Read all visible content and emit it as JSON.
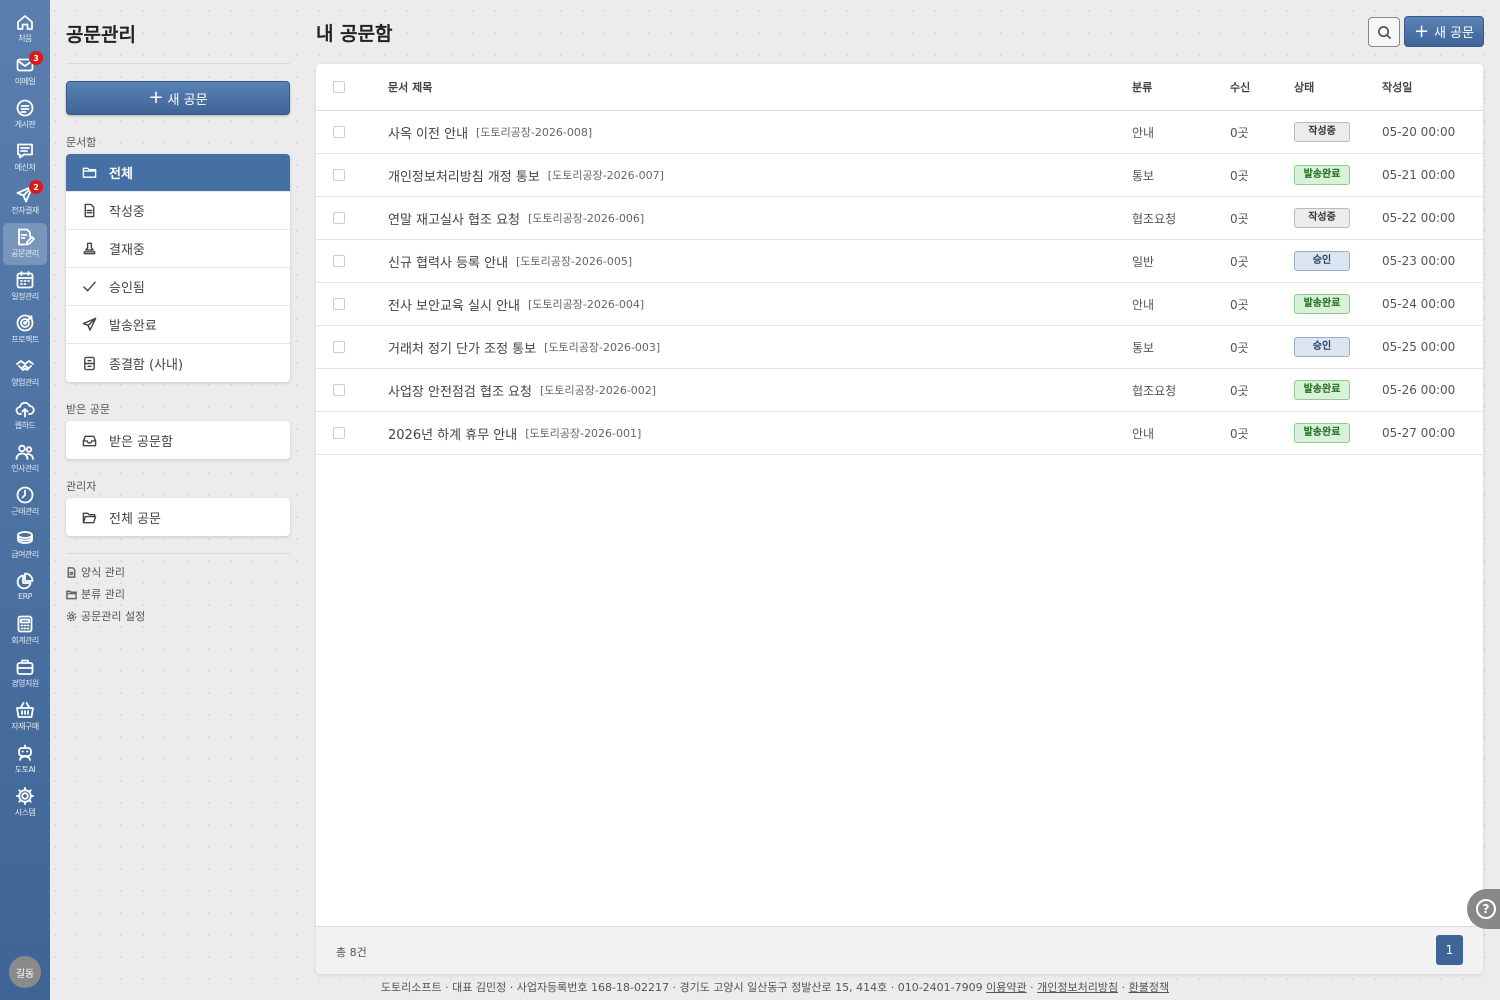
{
  "rail": {
    "items": [
      {
        "label": "처음",
        "icon": "home-icon",
        "badge": ""
      },
      {
        "label": "이메일",
        "icon": "mail-icon",
        "badge": "3"
      },
      {
        "label": "게시판",
        "icon": "board-icon",
        "badge": ""
      },
      {
        "label": "메신저",
        "icon": "chat-icon",
        "badge": ""
      },
      {
        "label": "전자결재",
        "icon": "send-icon",
        "badge": "2"
      },
      {
        "label": "공문관리",
        "icon": "document-edit-icon",
        "badge": ""
      },
      {
        "label": "일정관리",
        "icon": "calendar-icon",
        "badge": ""
      },
      {
        "label": "프로젝트",
        "icon": "target-icon",
        "badge": ""
      },
      {
        "label": "영업관리",
        "icon": "handshake-icon",
        "badge": ""
      },
      {
        "label": "웹하드",
        "icon": "cloud-upload-icon",
        "badge": ""
      },
      {
        "label": "인사관리",
        "icon": "people-icon",
        "badge": ""
      },
      {
        "label": "근태관리",
        "icon": "clock-icon",
        "badge": ""
      },
      {
        "label": "급여관리",
        "icon": "coins-icon",
        "badge": ""
      },
      {
        "label": "ERP",
        "icon": "pie-chart-icon",
        "badge": ""
      },
      {
        "label": "회계관리",
        "icon": "calculator-icon",
        "badge": ""
      },
      {
        "label": "경영지원",
        "icon": "briefcase-icon",
        "badge": ""
      },
      {
        "label": "자재구매",
        "icon": "basket-icon",
        "badge": ""
      },
      {
        "label": "도토AI",
        "icon": "robot-icon",
        "badge": ""
      },
      {
        "label": "시스템",
        "icon": "gear-icon",
        "badge": ""
      }
    ],
    "avatar": "길동"
  },
  "sidebar": {
    "title": "공문관리",
    "new_button": "새 공문",
    "section_docbox": "문서함",
    "docbox": [
      "전체",
      "작성중",
      "결재중",
      "승인됨",
      "발송완료",
      "종결함 (사내)"
    ],
    "section_received": "받은 공문",
    "received": [
      "받은 공문함"
    ],
    "section_admin": "관리자",
    "admin": [
      "전체 공문"
    ],
    "links": [
      "양식 관리",
      "분류 관리",
      "공문관리 설정"
    ]
  },
  "header": {
    "title": "내 공문함",
    "new_button": "새 공문"
  },
  "table": {
    "headers": {
      "title": "문서 제목",
      "category": "분류",
      "recipients": "수신",
      "status": "상태",
      "date": "작성일"
    },
    "rows": [
      {
        "title": "사옥 이전 안내",
        "doc_no": "[도토리공장-2026-008]",
        "category": "안내",
        "recipients": "0곳",
        "status": "작성중",
        "status_type": "draft",
        "date": "05-20 00:00"
      },
      {
        "title": "개인정보처리방침 개정 통보",
        "doc_no": "[도토리공장-2026-007]",
        "category": "통보",
        "recipients": "0곳",
        "status": "발송완료",
        "status_type": "sent",
        "date": "05-21 00:00"
      },
      {
        "title": "연말 재고실사 협조 요청",
        "doc_no": "[도토리공장-2026-006]",
        "category": "협조요청",
        "recipients": "0곳",
        "status": "작성중",
        "status_type": "draft",
        "date": "05-22 00:00"
      },
      {
        "title": "신규 협력사 등록 안내",
        "doc_no": "[도토리공장-2026-005]",
        "category": "일반",
        "recipients": "0곳",
        "status": "승인",
        "status_type": "approved",
        "date": "05-23 00:00"
      },
      {
        "title": "전사 보안교육 실시 안내",
        "doc_no": "[도토리공장-2026-004]",
        "category": "안내",
        "recipients": "0곳",
        "status": "발송완료",
        "status_type": "sent",
        "date": "05-24 00:00"
      },
      {
        "title": "거래처 정기 단가 조정 통보",
        "doc_no": "[도토리공장-2026-003]",
        "category": "통보",
        "recipients": "0곳",
        "status": "승인",
        "status_type": "approved",
        "date": "05-25 00:00"
      },
      {
        "title": "사업장 안전점검 협조 요청",
        "doc_no": "[도토리공장-2026-002]",
        "category": "협조요청",
        "recipients": "0곳",
        "status": "발송완료",
        "status_type": "sent",
        "date": "05-26 00:00"
      },
      {
        "title": "2026년 하계 휴무 안내",
        "doc_no": "[도토리공장-2026-001]",
        "category": "안내",
        "recipients": "0곳",
        "status": "발송완료",
        "status_type": "sent",
        "date": "05-27 00:00"
      }
    ],
    "total": "총 8건",
    "current_page": "1"
  },
  "help_icon": "?",
  "footer": {
    "text": "도토리소프트 · 대표 김민정 · 사업자등록번호 168-18-02217 · 경기도 고양시 일산동구 정발산로 15, 414호 · 010-2401-7909",
    "links": [
      "이용약관",
      "개인정보처리방침",
      "환불정책"
    ]
  },
  "colors": {
    "accent": "#4470a4",
    "rail": "#4a70a0",
    "badge_red": "#d81b1b",
    "status_sent": "#d9f1d9",
    "status_approved": "#dce6f3",
    "status_draft": "#ececec"
  }
}
